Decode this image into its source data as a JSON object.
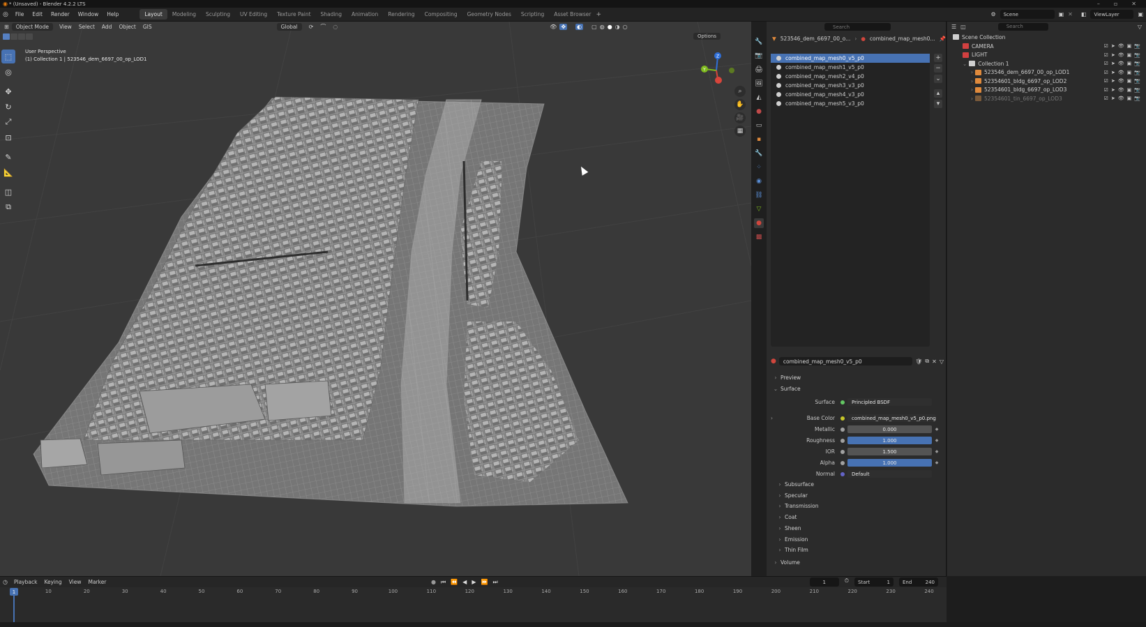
{
  "window": {
    "title": "* (Unsaved) - Blender 4.2.2 LTS"
  },
  "menu": [
    "File",
    "Edit",
    "Render",
    "Window",
    "Help"
  ],
  "workspaces": [
    "Layout",
    "Modeling",
    "Sculpting",
    "UV Editing",
    "Texture Paint",
    "Shading",
    "Animation",
    "Rendering",
    "Compositing",
    "Geometry Nodes",
    "Scripting",
    "Asset Browser"
  ],
  "active_workspace": "Layout",
  "topbar": {
    "scene": "Scene",
    "view_layer": "ViewLayer",
    "add_tab": "+"
  },
  "viewport": {
    "mode": "Object Mode",
    "menus": [
      "View",
      "Select",
      "Add",
      "Object",
      "GIS"
    ],
    "orientation": "Global",
    "options": "Options",
    "info_line1": "User Perspective",
    "info_line2": "(1) Collection 1 | 523546_dem_6697_00_op_LOD1",
    "gizmo": {
      "z": "Z",
      "y": "Y",
      "x": "X"
    }
  },
  "properties": {
    "breadcrumb_object": "523546_dem_6697_00_o...",
    "breadcrumb_material": "combined_map_mesh0...",
    "search_placeholder": "Search",
    "slots": [
      "combined_map_mesh0_v5_p0",
      "combined_map_mesh1_v5_p0",
      "combined_map_mesh2_v4_p0",
      "combined_map_mesh3_v3_p0",
      "combined_map_mesh4_v3_p0",
      "combined_map_mesh5_v3_p0"
    ],
    "selected_slot": 0,
    "material_name": "combined_map_mesh0_v5_p0",
    "panels": {
      "preview": "Preview",
      "surface": "Surface",
      "subpanels": [
        "Subsurface",
        "Specular",
        "Transmission",
        "Coat",
        "Sheen",
        "Emission",
        "Thin Film"
      ],
      "volume": "Volume"
    },
    "surface": {
      "surface_label": "Surface",
      "surface_value": "Principled BSDF",
      "base_color_label": "Base Color",
      "base_color_value": "combined_map_mesh0_v5_p0.png",
      "metallic_label": "Metallic",
      "metallic_value": "0.000",
      "roughness_label": "Roughness",
      "roughness_value": "1.000",
      "ior_label": "IOR",
      "ior_value": "1.500",
      "alpha_label": "Alpha",
      "alpha_value": "1.000",
      "normal_label": "Normal",
      "normal_value": "Default"
    }
  },
  "outliner": {
    "search_placeholder": "Search",
    "root": "Scene Collection",
    "items": [
      {
        "name": "CAMERA",
        "color": "#d24040"
      },
      {
        "name": "LIGHT",
        "color": "#d24040"
      },
      {
        "name": "Collection 1",
        "color": "#cfcfcf"
      },
      {
        "name": "523546_dem_6697_00_op_LOD1",
        "color": "#e08a3c"
      },
      {
        "name": "52354601_bldg_6697_op_LOD2",
        "color": "#e08a3c"
      },
      {
        "name": "52354601_bldg_6697_op_LOD3",
        "color": "#e08a3c"
      },
      {
        "name": "52354601_tin_6697_op_LOD3",
        "color": "#7a5a3a"
      }
    ]
  },
  "timeline": {
    "menus": [
      "Playback",
      "Keying",
      "View",
      "Marker"
    ],
    "current_frame": "1",
    "start_label": "Start",
    "start_value": "1",
    "end_label": "End",
    "end_value": "240",
    "ticks": [
      "1",
      "10",
      "20",
      "30",
      "40",
      "50",
      "60",
      "70",
      "80",
      "90",
      "100",
      "110",
      "120",
      "130",
      "140",
      "150",
      "160",
      "170",
      "180",
      "190",
      "200",
      "210",
      "220",
      "230",
      "240"
    ]
  },
  "colors": {
    "accent": "#4772b3",
    "bg": "#393939",
    "panel": "#2b2b2b"
  }
}
